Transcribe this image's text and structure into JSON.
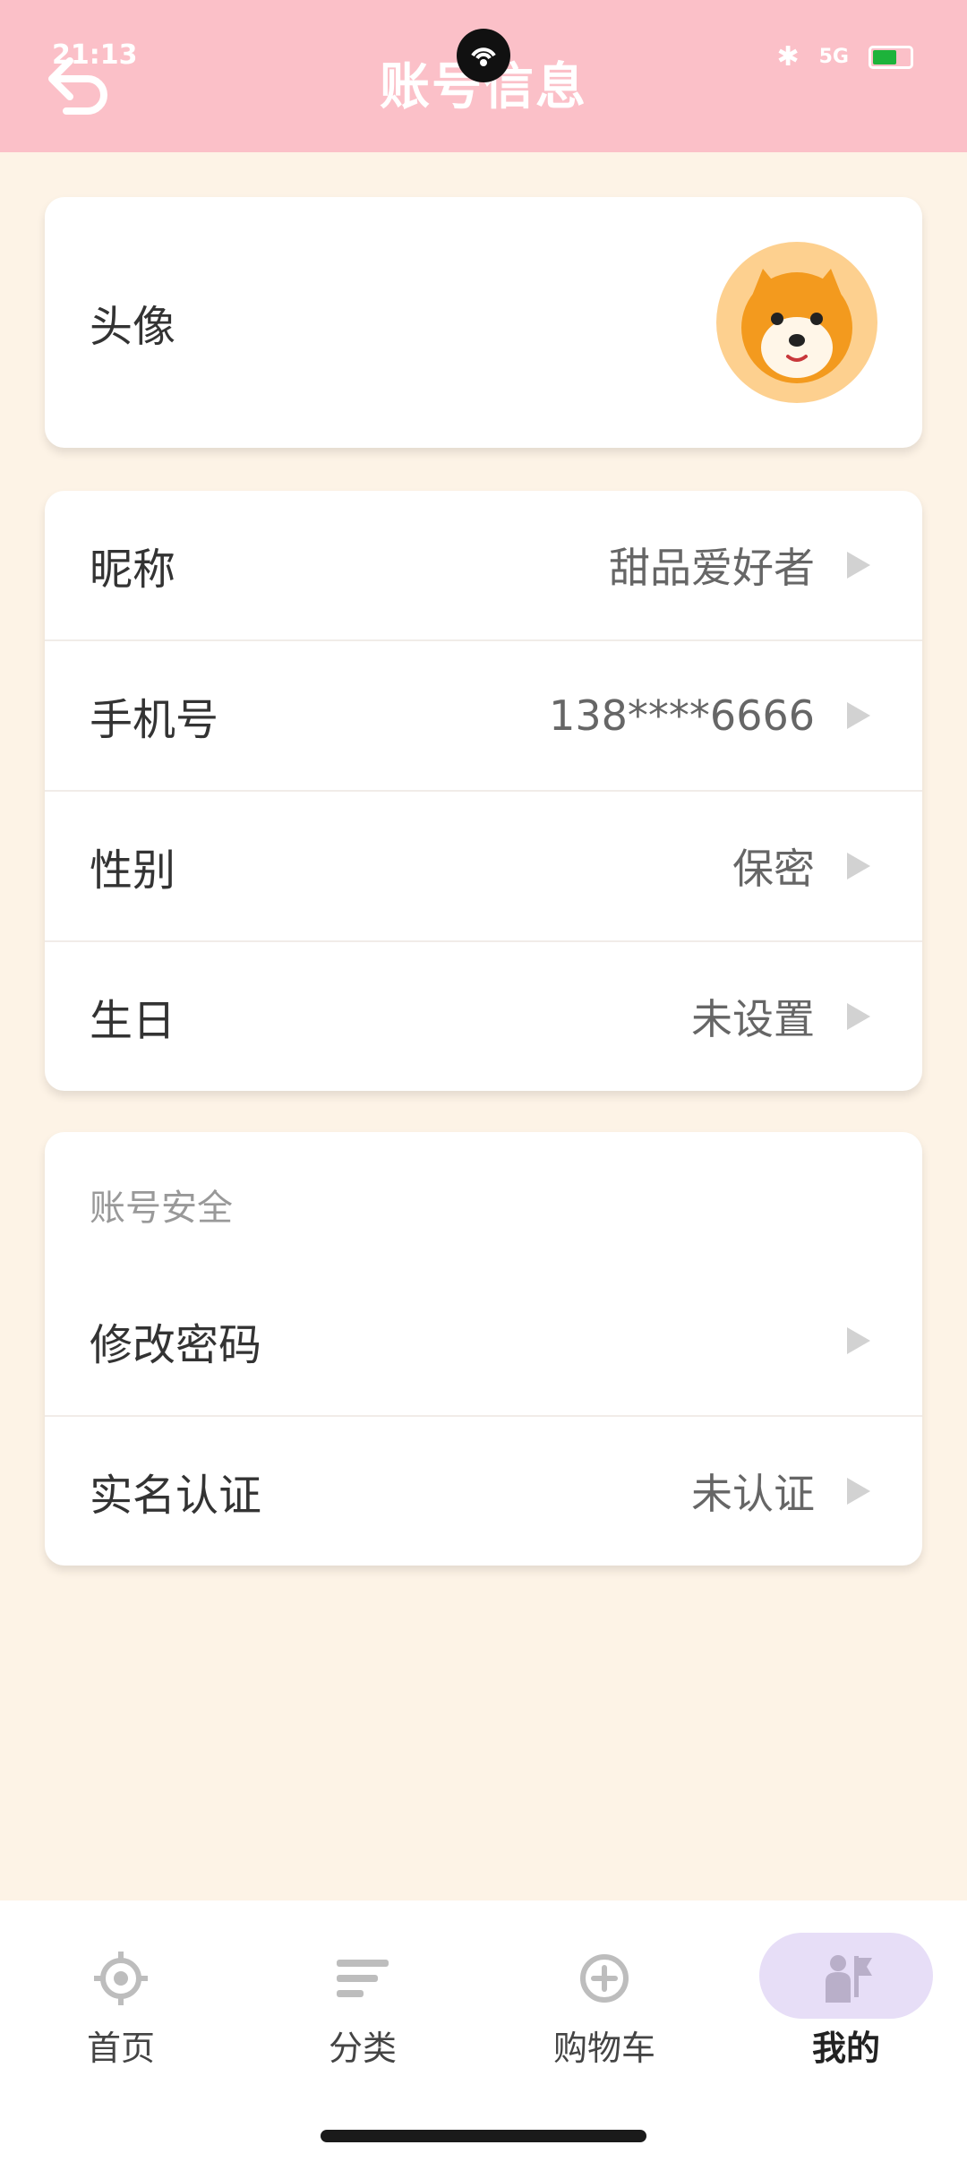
{
  "status": {
    "time": "21:13",
    "signal": "5G",
    "bluetooth_icon": "bluetooth-icon",
    "battery_color": "#1DB33B"
  },
  "header": {
    "title": "账号信息",
    "back_icon": "back-arrow-icon",
    "background": "#FBC0C8"
  },
  "profile": {
    "avatar_label": "头像",
    "avatar_icon": "dog-avatar-icon"
  },
  "info": {
    "rows": [
      {
        "label": "昵称",
        "value": "甜品爱好者"
      },
      {
        "label": "手机号",
        "value": "138****6666"
      },
      {
        "label": "性别",
        "value": "保密"
      },
      {
        "label": "生日",
        "value": "未设置"
      }
    ]
  },
  "security": {
    "section_title": "账号安全",
    "rows": [
      {
        "label": "修改密码",
        "value": ""
      },
      {
        "label": "实名认证",
        "value": "未认证"
      }
    ]
  },
  "nav": {
    "items": [
      {
        "label": "首页",
        "icon": "compass-icon"
      },
      {
        "label": "分类",
        "icon": "list-icon"
      },
      {
        "label": "购物车",
        "icon": "plus-circle-icon"
      },
      {
        "label": "我的",
        "icon": "user-flag-icon",
        "active": true
      }
    ],
    "active_color": "#E7DEF7"
  }
}
